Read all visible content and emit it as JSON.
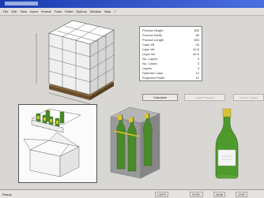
{
  "app": {
    "title": "",
    "status_text": "Ready"
  },
  "menu": [
    "File",
    "Edit",
    "View",
    "Insert",
    "Format",
    "Tools",
    "Pallet",
    "Options",
    "Window",
    "Help",
    "?"
  ],
  "params": [
    {
      "label": "Product Height",
      "value": "300"
    },
    {
      "label": "Product Width",
      "value": "80"
    },
    {
      "label": "Product Length",
      "value": "300"
    },
    {
      "label": "Case Wt",
      "value": "40"
    },
    {
      "label": "Case Wt",
      "value": "42.5"
    },
    {
      "label": "Layer Wt",
      "value": "40.0"
    },
    {
      "label": "No. Layers",
      "value": "4"
    },
    {
      "label": "No. Cases",
      "value": "3"
    },
    {
      "label": "Layers",
      "value": "4"
    },
    {
      "label": "Optimize Case",
      "value": "10"
    },
    {
      "label": "Projected Pallet",
      "value": "12"
    },
    {
      "label": "Projected Case",
      "value": "300"
    }
  ],
  "buttons": {
    "calculate": "Calculate",
    "load": "Load Product",
    "tuned": "Tuned Cases"
  },
  "status": {
    "cell1": "CAPS",
    "cell2": "SCRL",
    "cell3": "NUM",
    "cell4": "OVR"
  },
  "colors": {
    "titlebar": "#1a3bb0",
    "panel_bg": "#d9d7d3",
    "bottle_green": "#4a8a2a",
    "case_gray": "#9a9a9a"
  }
}
